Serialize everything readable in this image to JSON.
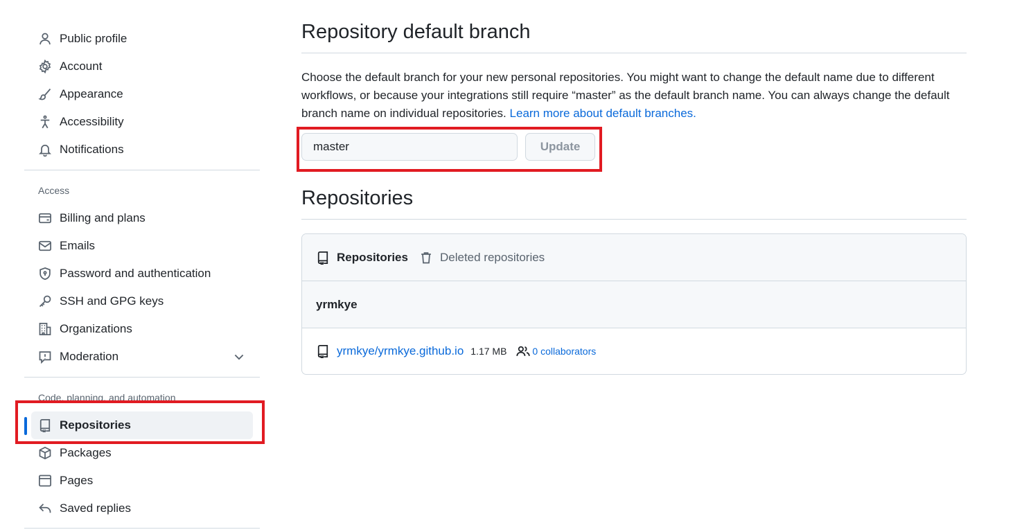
{
  "sidebar": {
    "personal_items": [
      {
        "label": "Public profile",
        "icon": "person-icon"
      },
      {
        "label": "Account",
        "icon": "gear-icon"
      },
      {
        "label": "Appearance",
        "icon": "paintbrush-icon"
      },
      {
        "label": "Accessibility",
        "icon": "accessibility-icon"
      },
      {
        "label": "Notifications",
        "icon": "bell-icon"
      }
    ],
    "access_heading": "Access",
    "access_items": [
      {
        "label": "Billing and plans",
        "icon": "credit-card-icon"
      },
      {
        "label": "Emails",
        "icon": "mail-icon"
      },
      {
        "label": "Password and authentication",
        "icon": "shield-lock-icon"
      },
      {
        "label": "SSH and GPG keys",
        "icon": "key-icon"
      },
      {
        "label": "Organizations",
        "icon": "organization-icon"
      },
      {
        "label": "Moderation",
        "icon": "report-icon"
      }
    ],
    "code_heading": "Code, planning, and automation",
    "code_items": [
      {
        "label": "Repositories",
        "icon": "repo-icon",
        "active": true
      },
      {
        "label": "Packages",
        "icon": "package-icon"
      },
      {
        "label": "Pages",
        "icon": "browser-icon"
      },
      {
        "label": "Saved replies",
        "icon": "reply-icon"
      }
    ]
  },
  "main": {
    "default_branch": {
      "title": "Repository default branch",
      "description": "Choose the default branch for your new personal repositories. You might want to change the default name due to different workflows, or because your integrations still require “master” as the default branch name. You can always change the default branch name on individual repositories.",
      "learn_more": "Learn more about default branches.",
      "input_value": "master",
      "update_label": "Update"
    },
    "repositories": {
      "title": "Repositories",
      "tabs": [
        {
          "label": "Repositories",
          "icon": "repo-icon",
          "selected": true
        },
        {
          "label": "Deleted repositories",
          "icon": "trash-icon",
          "selected": false
        }
      ],
      "owner": "yrmkye",
      "rows": [
        {
          "name": "yrmkye/yrmkye.github.io",
          "size": "1.17 MB",
          "collaborators": "0 collaborators"
        }
      ]
    }
  },
  "colors": {
    "accent": "#0969da",
    "highlight": "#e11b22",
    "muted": "#59636e"
  }
}
